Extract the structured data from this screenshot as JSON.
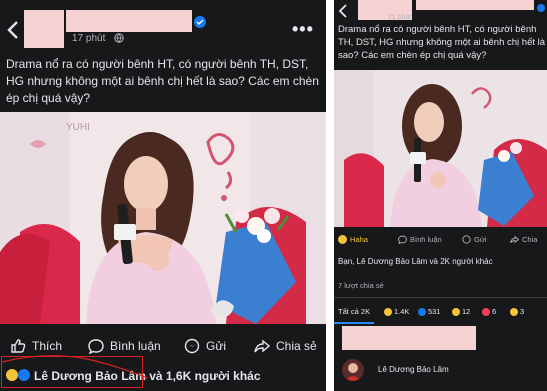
{
  "left": {
    "time": "17 phút",
    "post_text": "Drama nổ ra có người bênh HT, có người bênh TH, DST, HG nhưng không một ai bênh chị hết là sao? Các em chèn ép chị quá vậy?",
    "photo_brand": "YUHI",
    "actions": {
      "like": "Thích",
      "comment": "Bình luận",
      "send": "Gửi",
      "share": "Chia sẻ"
    },
    "reactions_text": "Lê Dương Bảo Lâm và 1,6K người khác",
    "more": "•••"
  },
  "right": {
    "time": "21 phút",
    "post_text": "Drama nổ ra có người bênh HT, có người bênh TH, DST, HG nhưng không một ai bênh chị hết là sao? Các em chèn ép chị quá vậy?",
    "actions": {
      "haha": "Haha",
      "comment": "Bình luận",
      "send": "Gửi",
      "share": "Chia"
    },
    "reactions_text": "Bạn, Lê Dương Bảo Lâm và 2K người khác",
    "share_count": "7 lượt chia sẻ",
    "tabs": {
      "all": "Tất cả 2K",
      "t1": "1.4K",
      "t2": "531",
      "t3": "12",
      "t4": "6",
      "t5": "3"
    },
    "person_name": "Lê Dương Bảo Lâm"
  },
  "colors": {
    "panel_bg": "#17181a",
    "text": "#e4e6eb",
    "muted": "#b0b3b8",
    "accent": "#1877f2",
    "highlight": "#d62222",
    "blur": "#f6d2d2"
  }
}
